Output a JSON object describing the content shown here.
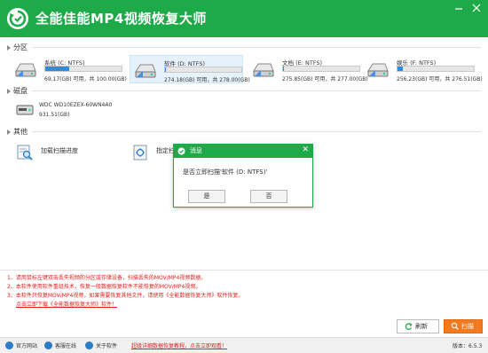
{
  "app": {
    "title": "全能佳能MP4视频恢复大师",
    "accent_color": "#1faa4a"
  },
  "window_controls": [
    "minimize-icon",
    "close-icon"
  ],
  "sections": {
    "partitions": "分区",
    "disks": "磁盘",
    "others": "其他"
  },
  "partitions": [
    {
      "name": "系统 (C: NTFS)",
      "size": "69.17(GB) 可用，共 100.00(GB)",
      "used_fraction": 0.31,
      "selected": false
    },
    {
      "name": "软件 (D: NTFS)",
      "size": "274.18(GB) 可用，共 278.00(GB)",
      "used_fraction": 0.014,
      "selected": true
    },
    {
      "name": "文档 (E: NTFS)",
      "size": "275.85(GB) 可用，共 277.00(GB)",
      "used_fraction": 0.004,
      "selected": false
    },
    {
      "name": "娱乐 (F: NTFS)",
      "size": "256.23(GB) 可用，共 276.51(GB)",
      "used_fraction": 0.07,
      "selected": false
    }
  ],
  "disks": [
    {
      "name": "WDC WD10EZEX-60WN4A0",
      "size": "931.51(GB)"
    }
  ],
  "others": [
    {
      "label": "加载扫描进度"
    },
    {
      "label": "指定扫"
    }
  ],
  "dialog": {
    "title": "消息",
    "message": "是否立即扫描'软件 (D: NTFS)'",
    "yes_label": "是",
    "no_label": "否"
  },
  "tips": [
    "1、请用鼠标左键双击丢失视频的分区或存储设备，扫描丢失的MOV/MP4视频数据。",
    "2、本软件使用软件重组技术，恢复一般数据恢复软件不能恢复的MOV/MP4视频。",
    "3、本软件只恢复MOV/MP4视频，如果需要恢复其他文件，请使用《全能数据恢复大师》软件恢复。",
    "点击立即下载《全能数据恢复大师》软件！"
  ],
  "actions": {
    "refresh_label": "刷新",
    "scan_label": "扫描"
  },
  "status_bar": {
    "website_label": "官方网站",
    "support_label": "客服在线",
    "about_label": "关于软件",
    "promo_text": "超级详细数据恢复教程，点击立即观看！",
    "version": "版本：6.5.3"
  }
}
